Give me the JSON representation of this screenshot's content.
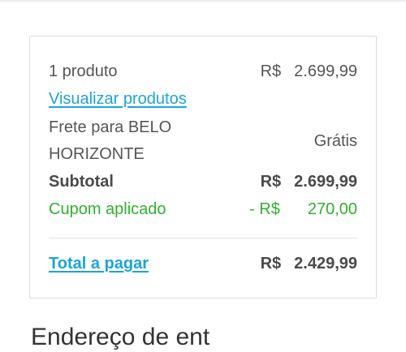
{
  "summary": {
    "products_count_label": "1 produto",
    "products_price_currency": "R$",
    "products_price_value": "2.699,99",
    "view_products_link": "Visualizar produtos",
    "shipping_label_line1": "Frete para BELO",
    "shipping_label_line2": "HORIZONTE",
    "shipping_value": "Grátis",
    "subtotal_label": "Subtotal",
    "subtotal_currency": "R$",
    "subtotal_value": "2.699,99",
    "coupon_label": "Cupom aplicado",
    "coupon_currency": "- R$",
    "coupon_value": "270,00",
    "total_label": "Total a pagar",
    "total_currency": "R$",
    "total_value": "2.429,99"
  },
  "next_section": {
    "heading_partial": "Endereço de ent"
  },
  "colors": {
    "link": "#1aa5d6",
    "discount": "#2fb12f",
    "border": "#dcdcdc"
  }
}
